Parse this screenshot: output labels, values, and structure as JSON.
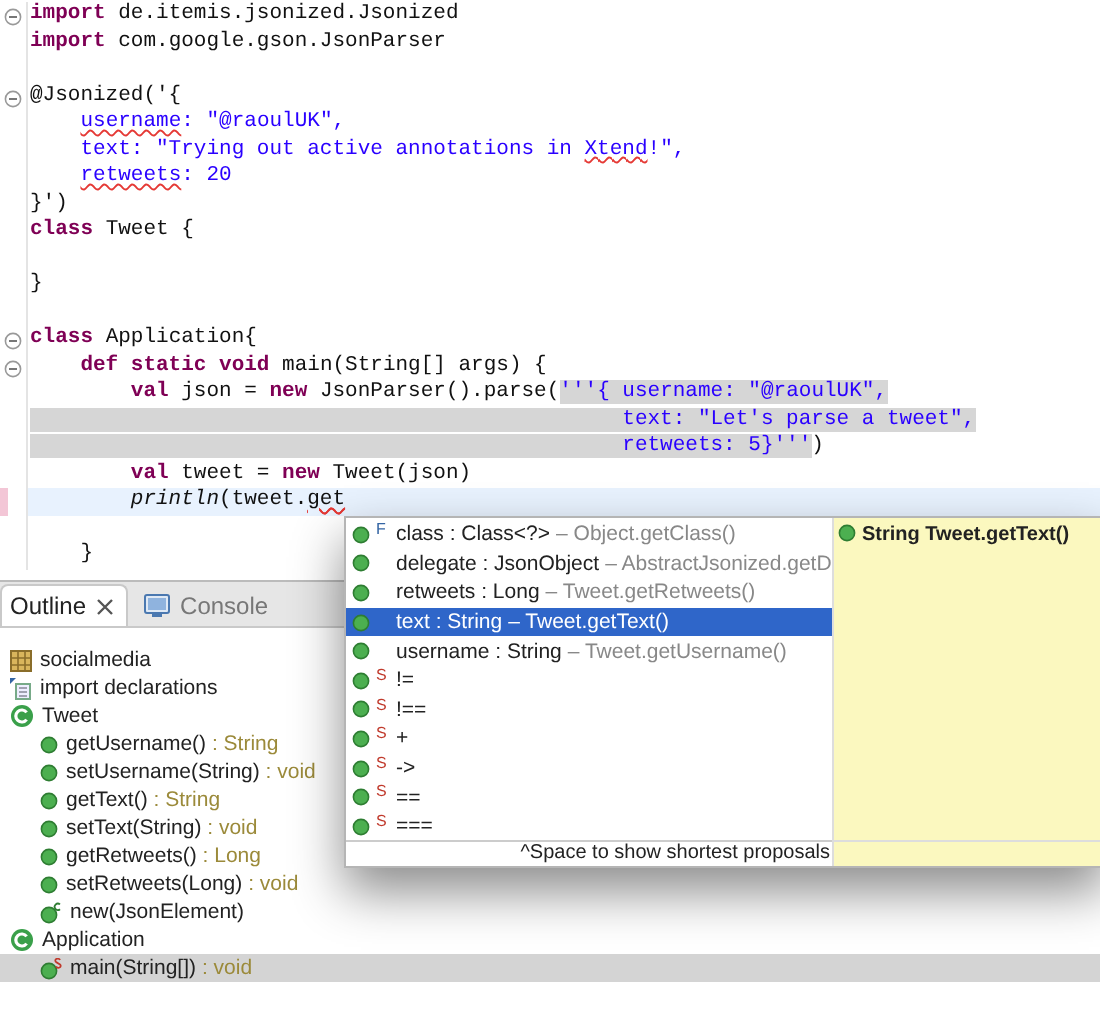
{
  "editor": {
    "lines": [
      {
        "fold": true,
        "current": false,
        "marker": false,
        "blank_before": false,
        "tokens": [
          {
            "text": "import",
            "kind": "keyword"
          },
          {
            "text": " de.itemis.jsonized.Jsonized",
            "kind": "plain"
          }
        ]
      },
      {
        "fold": false,
        "current": false,
        "marker": false,
        "blank_before": false,
        "tokens": [
          {
            "text": "import",
            "kind": "keyword"
          },
          {
            "text": " com.google.gson.JsonParser",
            "kind": "plain"
          }
        ]
      },
      {
        "fold": true,
        "current": false,
        "marker": false,
        "blank_before": true,
        "tokens": [
          {
            "text": "@Jsonized('{",
            "kind": "plain"
          }
        ]
      },
      {
        "fold": false,
        "current": false,
        "marker": false,
        "blank_before": false,
        "tokens": [
          {
            "text": "    username",
            "kind": "string_error"
          },
          {
            "text": ": \"@raoulUK\",",
            "kind": "string"
          }
        ]
      },
      {
        "fold": false,
        "current": false,
        "marker": false,
        "blank_before": false,
        "tokens": [
          {
            "text": "    text: \"Trying out active annotations in ",
            "kind": "string"
          },
          {
            "text": "Xtend",
            "kind": "string_error"
          },
          {
            "text": "!\",",
            "kind": "string"
          }
        ]
      },
      {
        "fold": false,
        "current": false,
        "marker": false,
        "blank_before": false,
        "tokens": [
          {
            "text": "    retweets",
            "kind": "string_error"
          },
          {
            "text": ": 20",
            "kind": "string"
          }
        ]
      },
      {
        "fold": false,
        "current": false,
        "marker": false,
        "blank_before": false,
        "tokens": [
          {
            "text": "}')",
            "kind": "plain"
          }
        ]
      },
      {
        "fold": false,
        "current": false,
        "marker": false,
        "blank_before": false,
        "tokens": [
          {
            "text": "class",
            "kind": "keyword"
          },
          {
            "text": " Tweet {",
            "kind": "plain"
          }
        ]
      },
      {
        "fold": false,
        "current": false,
        "marker": false,
        "blank_before": true,
        "tokens": [
          {
            "text": "}",
            "kind": "plain"
          }
        ]
      },
      {
        "fold": true,
        "current": false,
        "marker": false,
        "blank_before": true,
        "tokens": [
          {
            "text": "class",
            "kind": "keyword"
          },
          {
            "text": " Application{",
            "kind": "plain"
          }
        ]
      },
      {
        "fold": true,
        "current": false,
        "marker": false,
        "blank_before": false,
        "tokens": [
          {
            "text": "    def static void",
            "kind": "keyword"
          },
          {
            "text": " main(String[] args) {",
            "kind": "plain"
          }
        ]
      },
      {
        "fold": false,
        "current": false,
        "marker": false,
        "blank_before": false,
        "tokens": [
          {
            "text": "        val",
            "kind": "keyword"
          },
          {
            "text": " json = ",
            "kind": "plain"
          },
          {
            "text": "new",
            "kind": "keyword"
          },
          {
            "text": " JsonParser().parse(",
            "kind": "plain"
          },
          {
            "text": "'''{ username: \"@raoulUK\",",
            "kind": "embedded_string"
          }
        ]
      },
      {
        "fold": false,
        "current": false,
        "marker": false,
        "blank_before": false,
        "tokens": [
          {
            "text": "                                               text: \"Let's parse a tweet\",",
            "kind": "embedded_string"
          }
        ]
      },
      {
        "fold": false,
        "current": false,
        "marker": false,
        "blank_before": false,
        "tokens": [
          {
            "text": "                                               retweets: 5}'''",
            "kind": "embedded_string"
          },
          {
            "text": ")",
            "kind": "plain"
          }
        ]
      },
      {
        "fold": false,
        "current": false,
        "marker": false,
        "blank_before": false,
        "tokens": [
          {
            "text": "        val",
            "kind": "keyword"
          },
          {
            "text": " tweet = ",
            "kind": "plain"
          },
          {
            "text": "new",
            "kind": "keyword"
          },
          {
            "text": " Tweet(json)",
            "kind": "plain"
          }
        ]
      },
      {
        "fold": false,
        "current": true,
        "marker": true,
        "blank_before": false,
        "tokens": [
          {
            "text": "        println",
            "kind": "italic"
          },
          {
            "text": "(tweet.",
            "kind": "plain"
          },
          {
            "text": "get",
            "kind": "error"
          }
        ]
      },
      {
        "fold": false,
        "current": false,
        "marker": false,
        "blank_before": true,
        "tokens": [
          {
            "text": "    }",
            "kind": "plain"
          }
        ]
      }
    ]
  },
  "tabs": [
    {
      "label": "Outline",
      "kind": "outline",
      "selected": true
    },
    {
      "label": "Console",
      "kind": "console",
      "selected": false
    }
  ],
  "outline": [
    {
      "label": "socialmedia",
      "kind": "package",
      "selected": false
    },
    {
      "label": "import declarations",
      "kind": "imports",
      "selected": false
    },
    {
      "label": "Tweet",
      "kind": "class",
      "selected": false,
      "children": [
        {
          "label": "getUsername()",
          "type": ": String",
          "kind": "method",
          "selected": false
        },
        {
          "label": "setUsername(String)",
          "type": ": void",
          "kind": "method",
          "selected": false
        },
        {
          "label": "getText()",
          "type": ": String",
          "kind": "method",
          "selected": false
        },
        {
          "label": "setText(String)",
          "type": ": void",
          "kind": "method",
          "selected": false
        },
        {
          "label": "getRetweets()",
          "type": ": Long",
          "kind": "method",
          "selected": false
        },
        {
          "label": "setRetweets(Long)",
          "type": ": void",
          "kind": "method",
          "selected": false
        },
        {
          "label": "new(JsonElement)",
          "kind": "constructor",
          "selected": false
        }
      ]
    },
    {
      "label": "Application",
      "kind": "class",
      "selected": false,
      "children": [
        {
          "label": "main(String[])",
          "type": ": void",
          "kind": "static_method",
          "selected": true
        }
      ]
    }
  ],
  "completion": {
    "items": [
      {
        "label": "class : Class<?>",
        "source": "– Object.getClass()",
        "mark": "F",
        "selected": false
      },
      {
        "label": "delegate : JsonObject",
        "source": "– AbstractJsonized.getD",
        "selected": false
      },
      {
        "label": "retweets : Long",
        "source": "– Tweet.getRetweets()",
        "selected": false
      },
      {
        "label": "text : String",
        "source": "– Tweet.getText()",
        "selected": true
      },
      {
        "label": "username : String",
        "source": "– Tweet.getUsername()",
        "selected": false
      },
      {
        "label": "!=",
        "mark": "S",
        "selected": false
      },
      {
        "label": "!==",
        "mark": "S",
        "selected": false
      },
      {
        "label": "+",
        "mark": "S",
        "selected": false
      },
      {
        "label": "->",
        "mark": "S",
        "selected": false
      },
      {
        "label": "==",
        "mark": "S",
        "selected": false
      },
      {
        "label": "===",
        "mark": "S",
        "selected": false
      }
    ],
    "hint": "^Space to show shortest proposals",
    "doc": "String Tweet.getText()"
  }
}
